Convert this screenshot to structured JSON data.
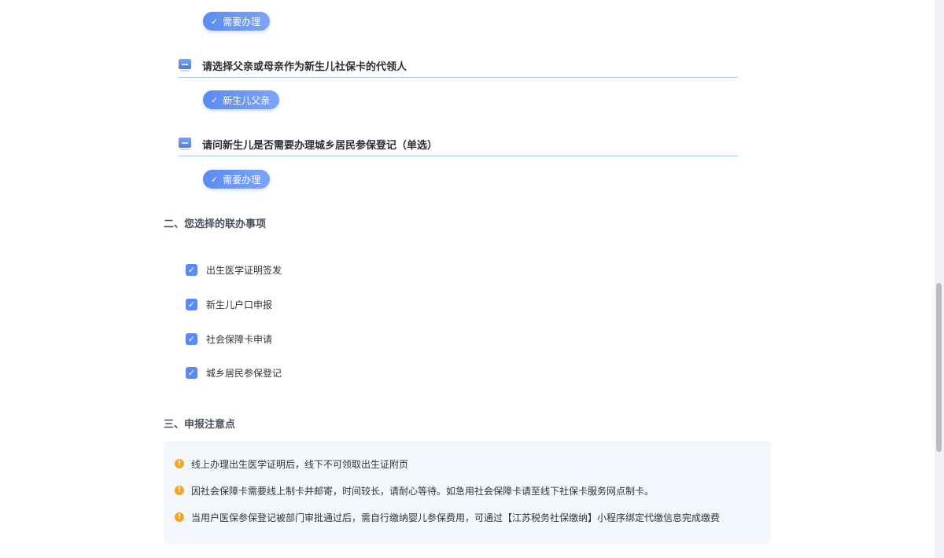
{
  "questions": [
    {
      "answer": "需要办理"
    },
    {
      "text": "请选择父亲或母亲作为新生儿社保卡的代领人",
      "answer": "新生儿父亲"
    },
    {
      "text": "请问新生儿是否需要办理城乡居民参保登记（单选）",
      "answer": "需要办理"
    }
  ],
  "section2": {
    "title": "二、您选择的联办事项",
    "items": [
      "出生医学证明签发",
      "新生儿户口申报",
      "社会保障卡申请",
      "城乡居民参保登记"
    ]
  },
  "section3": {
    "title": "三、申报注意点",
    "notices": [
      "线上办理出生医学证明后，线下不可领取出生证附页",
      "因社会保障卡需要线上制卡并邮寄，时间较长，请耐心等待。如急用社会保障卡请至线下社保卡服务网点制卡。",
      "当用户医保参保登记被部门审批通过后，需自行缴纳婴儿参保费用，可通过【江苏税务社保缴纳】小程序绑定代缴信息完成缴费"
    ]
  },
  "icons": {
    "chip_check": "check-icon",
    "question": "message-icon",
    "checkbox": "checkbox-checked-icon",
    "notice": "warning-icon"
  },
  "colors": {
    "accent": "#5b8bf0",
    "warning": "#f5a623",
    "notice_bg": "#f3f7fd"
  }
}
